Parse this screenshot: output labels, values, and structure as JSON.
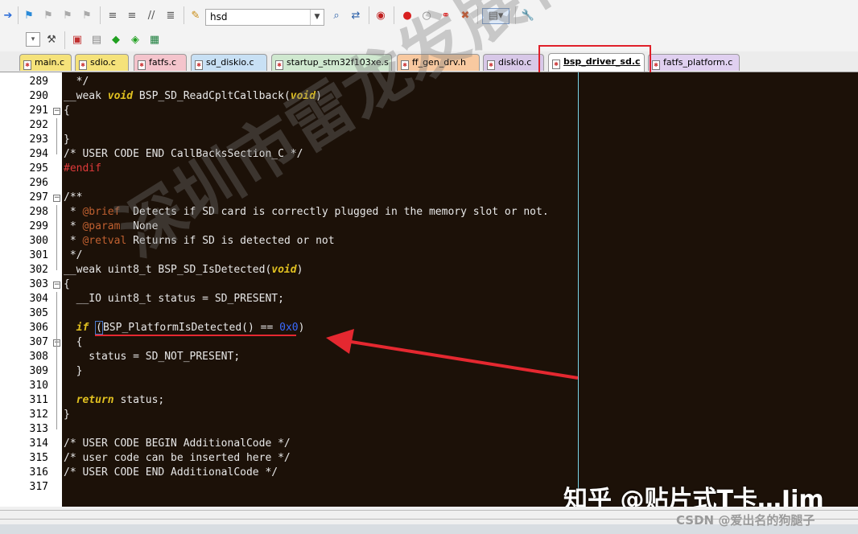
{
  "toolbar1": {
    "target_value": "hsd",
    "icons": [
      "arrow-right-icon",
      "bookmark-icon",
      "bookmark-prev-icon",
      "bookmark-next-icon",
      "bookmark-clear-icon",
      "indent-icon",
      "unindent-icon",
      "comment-icon",
      "uncomment-icon",
      "find-in-files-icon",
      "search-icon",
      "replace-icon",
      "debug-icon",
      "breakpoint-icon",
      "breakpoint-disable-icon",
      "breakpoint-kill-icon",
      "breakpoint-show-icon",
      "window-layout-icon",
      "wrench-icon"
    ]
  },
  "toolbar2": {
    "icons": [
      "dropdown-icon",
      "magic-wand-icon",
      "build-icon",
      "rebuild-icon",
      "download-icon",
      "diamond-icon",
      "load-icon"
    ]
  },
  "tabs": [
    {
      "label": "main.c",
      "color": "#f5e27a"
    },
    {
      "label": "sdio.c",
      "color": "#f5e27a"
    },
    {
      "label": "fatfs.c",
      "color": "#f4c4cc"
    },
    {
      "label": "sd_diskio.c",
      "color": "#c8e0f4"
    },
    {
      "label": "startup_stm32f103xe.s",
      "color": "#cfe8cf"
    },
    {
      "label": "ff_gen_drv.h",
      "color": "#f8c9a0"
    },
    {
      "label": "diskio.c",
      "color": "#d8c8e8"
    },
    {
      "label": "bsp_driver_sd.c",
      "color": "#ffffff",
      "active": true
    },
    {
      "label": "fatfs_platform.c",
      "color": "#e0d0f0"
    }
  ],
  "code": {
    "lines": [
      {
        "n": "289",
        "text": "  */"
      },
      {
        "n": "290",
        "text": "__weak void BSP_SD_ReadCpltCallback(void)"
      },
      {
        "n": "291",
        "text": "{"
      },
      {
        "n": "292",
        "text": ""
      },
      {
        "n": "293",
        "text": "}"
      },
      {
        "n": "294",
        "text": "/* USER CODE END CallBacksSection_C */"
      },
      {
        "n": "295",
        "text": "#endif"
      },
      {
        "n": "296",
        "text": ""
      },
      {
        "n": "297",
        "text": "/**"
      },
      {
        "n": "298",
        "text": " * @brief  Detects if SD card is correctly plugged in the memory slot or not."
      },
      {
        "n": "299",
        "text": " * @param  None"
      },
      {
        "n": "300",
        "text": " * @retval Returns if SD is detected or not"
      },
      {
        "n": "301",
        "text": " */"
      },
      {
        "n": "302",
        "text": "__weak uint8_t BSP_SD_IsDetected(void)"
      },
      {
        "n": "303",
        "text": "{"
      },
      {
        "n": "304",
        "text": "  __IO uint8_t status = SD_PRESENT;"
      },
      {
        "n": "305",
        "text": ""
      },
      {
        "n": "306",
        "text": "  if (BSP_PlatformIsDetected() == 0x0)"
      },
      {
        "n": "307",
        "text": "  {"
      },
      {
        "n": "308",
        "text": "    status = SD_NOT_PRESENT;"
      },
      {
        "n": "309",
        "text": "  }"
      },
      {
        "n": "310",
        "text": ""
      },
      {
        "n": "311",
        "text": "  return status;"
      },
      {
        "n": "312",
        "text": "}"
      },
      {
        "n": "313",
        "text": ""
      },
      {
        "n": "314",
        "text": "/* USER CODE BEGIN AdditionalCode */"
      },
      {
        "n": "315",
        "text": "/* user code can be inserted here */"
      },
      {
        "n": "316",
        "text": "/* USER CODE END AdditionalCode */"
      },
      {
        "n": "317",
        "text": ""
      }
    ]
  },
  "watermarks": {
    "company": "深圳市雷龙发展有限公司",
    "zhihu": "知乎 @贴片式T卡…Jim",
    "csdn": "CSDN @爱出名的狗腿子"
  }
}
